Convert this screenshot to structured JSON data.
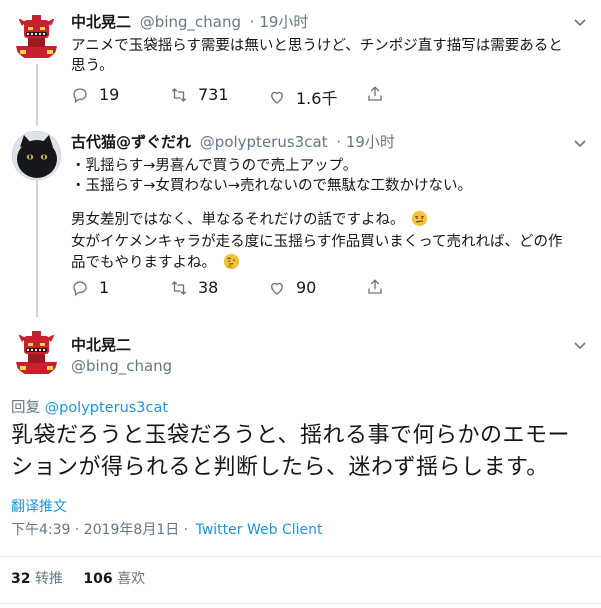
{
  "tweet1": {
    "name": "中北晃二",
    "handle": "@bing_chang",
    "time": "· 19小时",
    "lines": [
      "アニメで玉袋揺らす需要は無いと思うけど、チンポジ直す描写は需要あると",
      "思う。"
    ],
    "reply_count": "19",
    "retweet_count": "731",
    "like_count": "1.6千"
  },
  "tweet2": {
    "name": "古代猫@ずぐだれ",
    "handle": "@polypterus3cat",
    "time": "· 19小时",
    "lines": [
      "・乳揺らす→男喜んで買うので売上アップ。",
      "・玉揺らす→女買わない→売れないので無駄な工数かけない。",
      "",
      "男女差別ではなく、単なるそれだけの話ですよね。",
      "女がイケメンキャラが走る度に玉揺らす作品買いまくって売れれば、どの作",
      "品でもやりますよね。"
    ],
    "reply_count": "1",
    "retweet_count": "38",
    "like_count": "90"
  },
  "main_tweet": {
    "name": "中北晃二",
    "handle": "@bing_chang",
    "reply_prefix": "回复",
    "reply_to": "@polypterus3cat",
    "lines": [
      "乳袋だろうと玉袋だろうと、揺れる事で何らかのエモー",
      "ションが得られると判断したら、迷わず揺らします。"
    ],
    "translate": "翻译推文",
    "timestamp": "下午4:39 · 2019年8月1日 ·",
    "client": "Twitter Web Client",
    "retweets": "32",
    "retweets_label": "转推",
    "likes": "106",
    "likes_label": "喜欢"
  },
  "colors": {
    "accent": "#1b95e0",
    "secondary": "#657786",
    "avatar_red": "#c8202e",
    "divider": "#e6ecf0"
  },
  "icons": [
    "reply-icon",
    "retweet-icon",
    "like-icon",
    "share-icon",
    "caret-down-icon",
    "emoji-smirk-icon",
    "emoji-thinking-icon"
  ]
}
